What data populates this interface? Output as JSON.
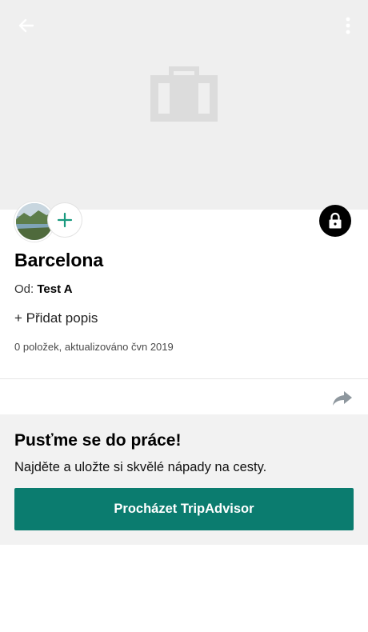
{
  "trip": {
    "title": "Barcelona",
    "by_label": "Od:",
    "author": "Test A",
    "add_description": "+ Přidat popis",
    "meta": "0 položek, aktualizováno čvn 2019"
  },
  "cta": {
    "heading": "Pusťme se do práce!",
    "subtitle": "Najděte a uložte si skvělé nápady na cesty.",
    "button_label": "Procházet TripAdvisor"
  },
  "icons": {
    "back": "back-arrow-icon",
    "more": "more-vertical-icon",
    "placeholder": "suitcase-icon",
    "add_collaborator": "plus-icon",
    "privacy": "lock-icon",
    "share": "share-icon"
  },
  "colors": {
    "accent": "#0b7c6f",
    "plus": "#1a9a7f",
    "hero_bg": "#efefef",
    "cta_bg": "#f2f2f2"
  }
}
